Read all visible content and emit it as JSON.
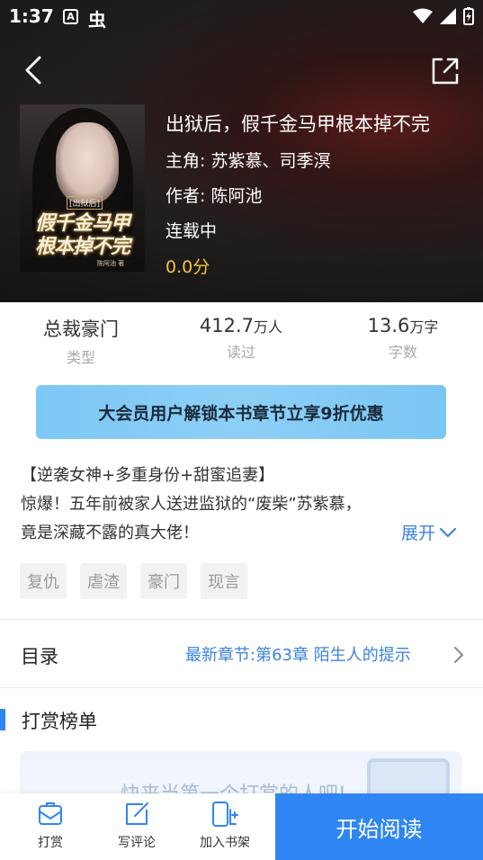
{
  "status_bar": {
    "time": "1:37",
    "app_icon_letter": "A",
    "app_glyph": "虫"
  },
  "book": {
    "title": "出狱后，假千金马甲根本掉不完",
    "protagonist": "主角: 苏紫慕、司季溟",
    "author": "作者: 陈阿池",
    "status": "连载中",
    "score": "0.0分",
    "cover": {
      "tag": "[出狱后]",
      "title_line1": "假千金马甲",
      "title_line2": "根本掉不完",
      "author": "陈阿池 著"
    }
  },
  "stats": [
    {
      "value": "总裁豪门",
      "unit": "",
      "label": "类型"
    },
    {
      "value": "412.7",
      "unit": "万人",
      "label": "读过"
    },
    {
      "value": "13.6",
      "unit": "万字",
      "label": "字数"
    }
  ],
  "vip_banner": "大会员用户解锁本书章节立享9折优惠",
  "intro": {
    "line1": "【逆袭女神+多重身份+甜蜜追妻】",
    "line2": "惊爆！五年前被家人送进监狱的“废柴”苏紫慕，",
    "line3": "竟是深藏不露的真大佬！",
    "expand": "展开"
  },
  "tags": [
    "复仇",
    "虐渣",
    "豪门",
    "现言"
  ],
  "toc": {
    "label": "目录",
    "latest": "最新章节:第63章 陌生人的提示"
  },
  "reward": {
    "title": "打赏榜单",
    "empty_text": "快来当第一个打赏的人吧!"
  },
  "bottom_bar": {
    "tip": "打赏",
    "review": "写评论",
    "add_shelf": "加入书架",
    "start_reading": "开始阅读"
  },
  "colors": {
    "accent": "#2f86f2",
    "link": "#3b82e0",
    "score": "#f6c343",
    "banner": "#7cc8f5"
  }
}
